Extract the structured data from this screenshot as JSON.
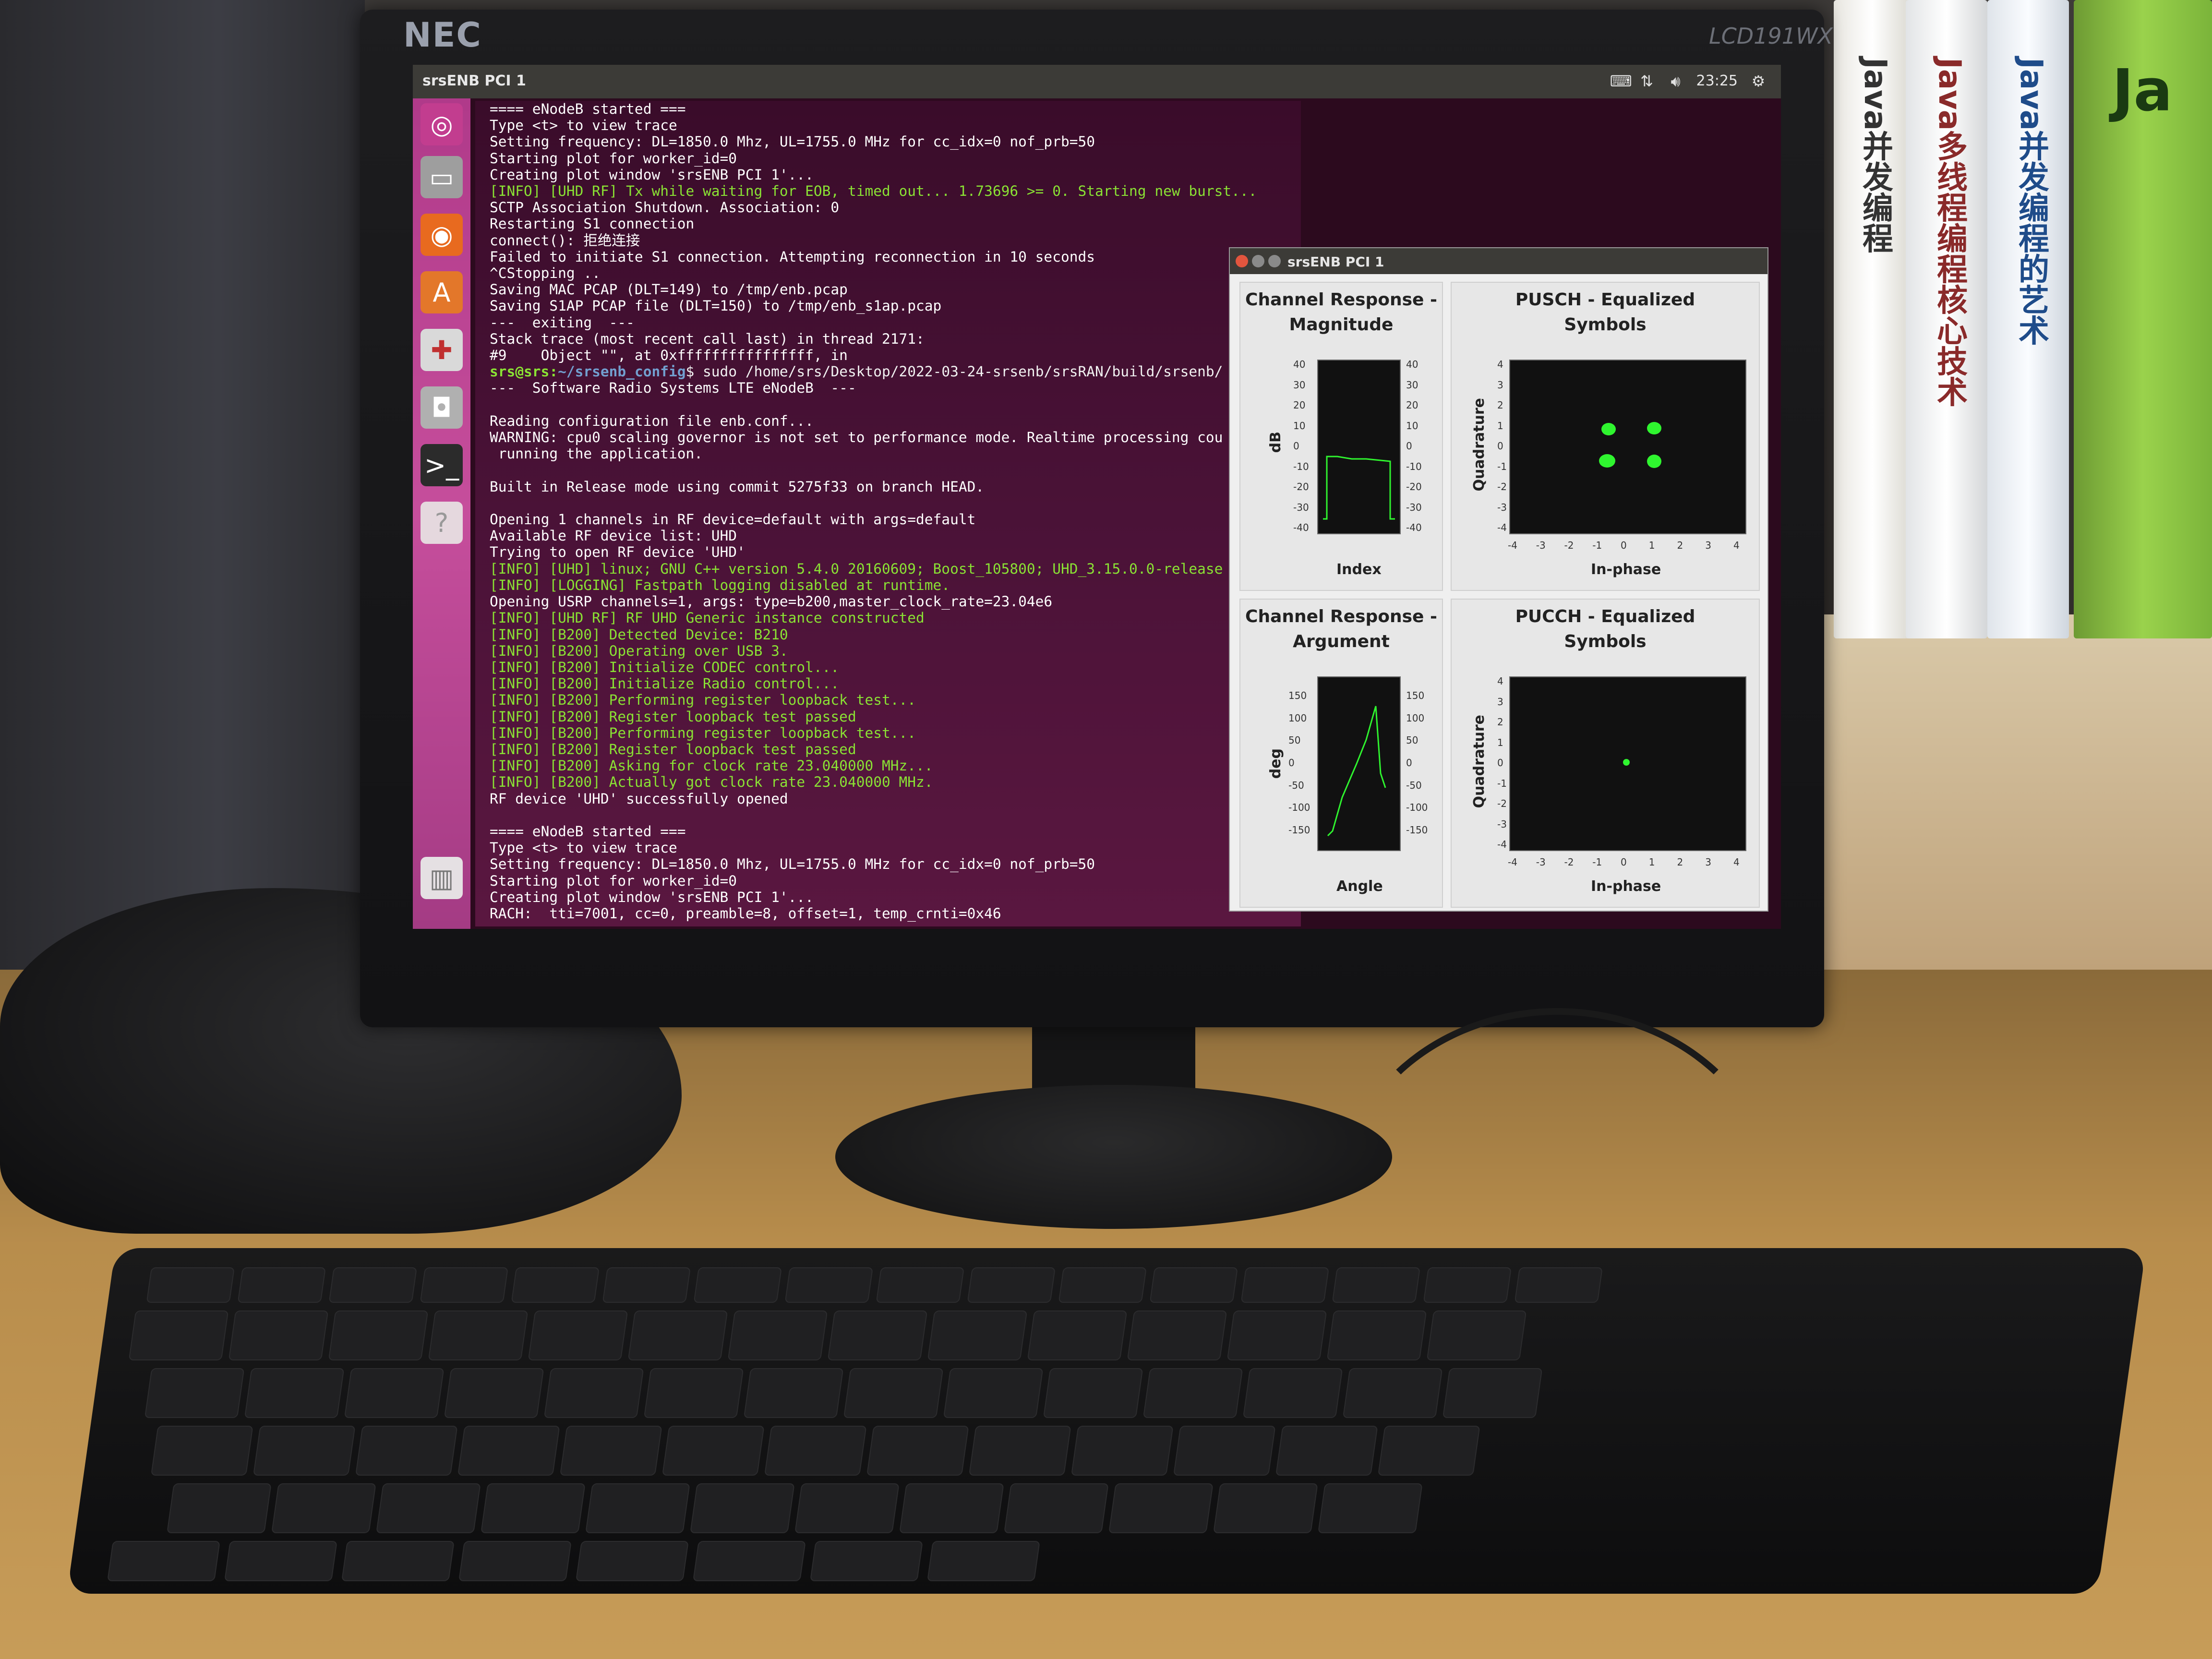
{
  "monitor": {
    "brand": "NEC",
    "model": "LCD191WX"
  },
  "topbar": {
    "title": "srsENB PCI 1",
    "time": "23:25"
  },
  "launcher": {
    "icons": [
      "ubuntu-dash-icon",
      "files-icon",
      "firefox-icon",
      "software-center-icon",
      "settings-icon",
      "camera-icon",
      "terminal-icon",
      "help-icon",
      "trash-icon"
    ]
  },
  "terminal": {
    "lines": [
      {
        "t": "==== eNodeB started ===",
        "c": "d"
      },
      {
        "t": "Type <t> to view trace",
        "c": "d"
      },
      {
        "t": "Setting frequency: DL=1850.0 Mhz, UL=1755.0 MHz for cc_idx=0 nof_prb=50",
        "c": "d"
      },
      {
        "t": "Starting plot for worker_id=0",
        "c": "d"
      },
      {
        "t": "Creating plot window 'srsENB PCI 1'...",
        "c": "d"
      },
      {
        "t": "[INFO] [UHD RF] Tx while waiting for EOB, timed out... 1.73696 >= 0. Starting new burst...",
        "c": "g"
      },
      {
        "t": "SCTP Association Shutdown. Association: 0",
        "c": "d"
      },
      {
        "t": "Restarting S1 connection",
        "c": "d"
      },
      {
        "t": "connect(): 拒绝连接",
        "c": "d"
      },
      {
        "t": "Failed to initiate S1 connection. Attempting reconnection in 10 seconds",
        "c": "d"
      },
      {
        "t": "^CStopping ..",
        "c": "d"
      },
      {
        "t": "Saving MAC PCAP (DLT=149) to /tmp/enb.pcap",
        "c": "d"
      },
      {
        "t": "Saving S1AP PCAP file (DLT=150) to /tmp/enb_s1ap.pcap",
        "c": "d"
      },
      {
        "t": "---  exiting  ---",
        "c": "d"
      },
      {
        "t": "Stack trace (most recent call last) in thread 2171:",
        "c": "d"
      },
      {
        "t": "#9    Object \"\", at 0xffffffffffffffff, in",
        "c": "d"
      },
      {
        "t": "srs@srs:~/srsenb_config$ sudo /home/srs/Desktop/2022-03-24-srsenb/srsRAN/build/srsenb/",
        "c": "prompt"
      },
      {
        "t": "---  Software Radio Systems LTE eNodeB  ---",
        "c": "d"
      },
      {
        "t": "",
        "c": "d"
      },
      {
        "t": "Reading configuration file enb.conf...",
        "c": "d"
      },
      {
        "t": "WARNING: cpu0 scaling governor is not set to performance mode. Realtime processing cou",
        "c": "d"
      },
      {
        "t": " running the application.",
        "c": "d"
      },
      {
        "t": "",
        "c": "d"
      },
      {
        "t": "Built in Release mode using commit 5275f33 on branch HEAD.",
        "c": "d"
      },
      {
        "t": "",
        "c": "d"
      },
      {
        "t": "Opening 1 channels in RF device=default with args=default",
        "c": "d"
      },
      {
        "t": "Available RF device list: UHD",
        "c": "d"
      },
      {
        "t": "Trying to open RF device 'UHD'",
        "c": "d"
      },
      {
        "t": "[INFO] [UHD] linux; GNU C++ version 5.4.0 20160609; Boost_105800; UHD_3.15.0.0-release",
        "c": "g"
      },
      {
        "t": "[INFO] [LOGGING] Fastpath logging disabled at runtime.",
        "c": "g"
      },
      {
        "t": "Opening USRP channels=1, args: type=b200,master_clock_rate=23.04e6",
        "c": "d"
      },
      {
        "t": "[INFO] [UHD RF] RF UHD Generic instance constructed",
        "c": "g"
      },
      {
        "t": "[INFO] [B200] Detected Device: B210",
        "c": "g"
      },
      {
        "t": "[INFO] [B200] Operating over USB 3.",
        "c": "g"
      },
      {
        "t": "[INFO] [B200] Initialize CODEC control...",
        "c": "g"
      },
      {
        "t": "[INFO] [B200] Initialize Radio control...",
        "c": "g"
      },
      {
        "t": "[INFO] [B200] Performing register loopback test...",
        "c": "g"
      },
      {
        "t": "[INFO] [B200] Register loopback test passed",
        "c": "g"
      },
      {
        "t": "[INFO] [B200] Performing register loopback test...",
        "c": "g"
      },
      {
        "t": "[INFO] [B200] Register loopback test passed",
        "c": "g"
      },
      {
        "t": "[INFO] [B200] Asking for clock rate 23.040000 MHz...",
        "c": "g"
      },
      {
        "t": "[INFO] [B200] Actually got clock rate 23.040000 MHz.",
        "c": "g"
      },
      {
        "t": "RF device 'UHD' successfully opened",
        "c": "d"
      },
      {
        "t": "",
        "c": "d"
      },
      {
        "t": "==== eNodeB started ===",
        "c": "d"
      },
      {
        "t": "Type <t> to view trace",
        "c": "d"
      },
      {
        "t": "Setting frequency: DL=1850.0 Mhz, UL=1755.0 MHz for cc_idx=0 nof_prb=50",
        "c": "d"
      },
      {
        "t": "Starting plot for worker_id=0",
        "c": "d"
      },
      {
        "t": "Creating plot window 'srsENB PCI 1'...",
        "c": "d"
      },
      {
        "t": "RACH:  tti=7001, cc=0, preamble=8, offset=1, temp_crnti=0x46",
        "c": "d"
      }
    ]
  },
  "plot_window": {
    "title": "srsENB PCI 1",
    "panels": {
      "mag": {
        "title1": "Channel Response -",
        "title2": "Magnitude",
        "ylabel": "dB",
        "xlabel": "Index",
        "yticks": [
          "40",
          "30",
          "20",
          "10",
          "0",
          "-10",
          "-20",
          "-30",
          "-40"
        ]
      },
      "pusch": {
        "title1": "PUSCH - Equalized",
        "title2": "Symbols",
        "ylabel": "Quadrature",
        "xlabel": "In-phase",
        "yticks": [
          "4",
          "3",
          "2",
          "1",
          "0",
          "-1",
          "-2",
          "-3",
          "-4"
        ],
        "xticks": [
          "-4",
          "-3",
          "-2",
          "-1",
          "0",
          "1",
          "2",
          "3",
          "4"
        ]
      },
      "arg": {
        "title1": "Channel Response -",
        "title2": "Argument",
        "ylabel": "deg",
        "xlabel": "Angle",
        "yticks": [
          "150",
          "100",
          "50",
          "0",
          "-50",
          "-100",
          "-150"
        ]
      },
      "pucch": {
        "title1": "PUCCH - Equalized",
        "title2": "Symbols",
        "ylabel": "Quadrature",
        "xlabel": "In-phase",
        "yticks": [
          "4",
          "3",
          "2",
          "1",
          "0",
          "-1",
          "-2",
          "-3",
          "-4"
        ],
        "xticks": [
          "-4",
          "-3",
          "-2",
          "-1",
          "0",
          "1",
          "2",
          "3",
          "4"
        ]
      }
    }
  },
  "books": {
    "b1": "Java并发编程",
    "b2": "Java多线程编程核心技术",
    "b3": "Java并发编程的艺术",
    "b4": "Ja"
  },
  "colors": {
    "launcher": "#c64e9c",
    "terminal_bg": "#4a1237",
    "plot_green": "#2ff52f"
  }
}
